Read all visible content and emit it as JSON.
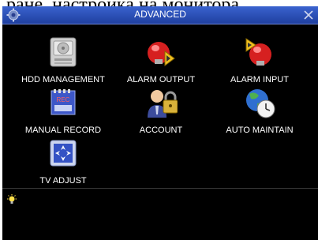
{
  "background_caption": "ране, настройка на монитора.",
  "window": {
    "title": "ADVANCED",
    "title_icon": "gear-icon",
    "close_icon": "close-icon",
    "accent_color": "#2c4fbf",
    "background_color": "#000000"
  },
  "menu": {
    "items": [
      {
        "label": "HDD MANAGEMENT",
        "icon": "hard-disk-icon"
      },
      {
        "label": "ALARM OUTPUT",
        "icon": "alarm-output-icon"
      },
      {
        "label": "ALARM INPUT",
        "icon": "alarm-input-icon"
      },
      {
        "label": "MANUAL RECORD",
        "icon": "manual-record-icon"
      },
      {
        "label": "ACCOUNT",
        "icon": "account-lock-icon"
      },
      {
        "label": "AUTO MAINTAIN",
        "icon": "auto-maintain-icon"
      },
      {
        "label": "TV ADJUST",
        "icon": "tv-adjust-icon"
      }
    ]
  },
  "status": {
    "tip_icon": "lightbulb-icon",
    "tip_text": ""
  }
}
